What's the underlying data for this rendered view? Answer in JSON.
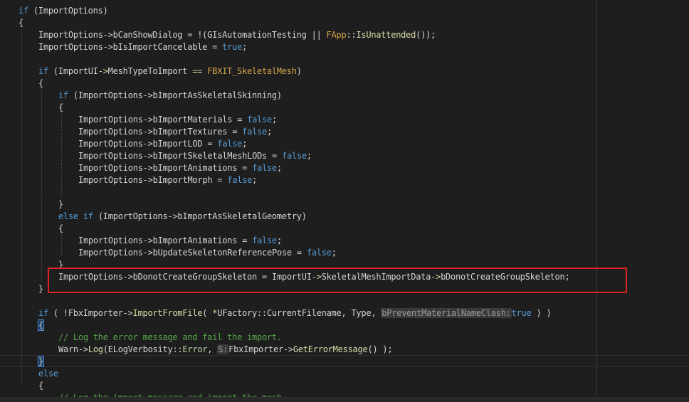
{
  "colors": {
    "keyword": "#569cd6",
    "identifier": "#d4d4d4",
    "member": "#d4d4d4",
    "function": "#dcdcaa",
    "enum": "#b8d7a3",
    "macro": "#d4a44a",
    "static": "#c8c8c8",
    "comment": "#57a64a",
    "operator_overload": "#dcdcaa",
    "warning_hl": "#d8a0df"
  },
  "code_lines": [
    {
      "indent": 0,
      "tokens": [
        [
          "if",
          "keyword"
        ],
        [
          " (ImportOptions)",
          "plain"
        ]
      ]
    },
    {
      "indent": 0,
      "tokens": [
        [
          "{",
          "plain"
        ]
      ]
    },
    {
      "indent": 1,
      "tokens": [
        [
          "ImportOptions->bCanShowDialog = !(",
          "plain"
        ],
        [
          "GIsAutomationTesting",
          "plain"
        ],
        [
          " || ",
          "plain"
        ],
        [
          "FApp",
          "macro"
        ],
        [
          "::",
          "plain"
        ],
        [
          "IsUnattended",
          "function"
        ],
        [
          "());",
          "plain"
        ]
      ]
    },
    {
      "indent": 1,
      "tokens": [
        [
          "ImportOptions->bIsImportCancelable = ",
          "plain"
        ],
        [
          "true",
          "keyword"
        ],
        [
          ";",
          "plain"
        ]
      ]
    },
    {
      "indent": 1,
      "tokens": []
    },
    {
      "indent": 1,
      "tokens": [
        [
          "if",
          "keyword"
        ],
        [
          " (ImportUI",
          "plain"
        ],
        [
          "->",
          "function"
        ],
        [
          "MeshTypeToImport",
          "plain"
        ],
        [
          " == ",
          "function"
        ],
        [
          "FBXIT_SkeletalMesh",
          "macro"
        ],
        [
          ")",
          "plain"
        ]
      ]
    },
    {
      "indent": 1,
      "tokens": [
        [
          "{",
          "plain"
        ]
      ]
    },
    {
      "indent": 2,
      "tokens": [
        [
          "if",
          "keyword"
        ],
        [
          " (ImportOptions->bImportAsSkeletalSkinning)",
          "plain"
        ]
      ]
    },
    {
      "indent": 2,
      "tokens": [
        [
          "{",
          "plain"
        ]
      ]
    },
    {
      "indent": 3,
      "tokens": [
        [
          "ImportOptions->bImportMaterials = ",
          "plain"
        ],
        [
          "false",
          "keyword"
        ],
        [
          ";",
          "plain"
        ]
      ]
    },
    {
      "indent": 3,
      "tokens": [
        [
          "ImportOptions->bImportTextures = ",
          "plain"
        ],
        [
          "false",
          "keyword"
        ],
        [
          ";",
          "plain"
        ]
      ]
    },
    {
      "indent": 3,
      "tokens": [
        [
          "ImportOptions->bImportLOD = ",
          "plain"
        ],
        [
          "false",
          "keyword"
        ],
        [
          ";",
          "plain"
        ]
      ]
    },
    {
      "indent": 3,
      "tokens": [
        [
          "ImportOptions->bImportSkeletalMeshLODs = ",
          "plain"
        ],
        [
          "false",
          "keyword"
        ],
        [
          ";",
          "plain"
        ]
      ]
    },
    {
      "indent": 3,
      "tokens": [
        [
          "ImportOptions->bImportAnimations = ",
          "plain"
        ],
        [
          "false",
          "keyword"
        ],
        [
          ";",
          "plain"
        ]
      ]
    },
    {
      "indent": 3,
      "tokens": [
        [
          "ImportOptions->bImportMorph = ",
          "plain"
        ],
        [
          "false",
          "keyword"
        ],
        [
          ";",
          "plain"
        ]
      ]
    },
    {
      "indent": 3,
      "tokens": []
    },
    {
      "indent": 2,
      "tokens": [
        [
          "}",
          "plain"
        ]
      ]
    },
    {
      "indent": 2,
      "tokens": [
        [
          "else",
          "keyword"
        ],
        [
          " ",
          "plain"
        ],
        [
          "if",
          "keyword"
        ],
        [
          " (ImportOptions->bImportAsSkeletalGeometry)",
          "plain"
        ]
      ]
    },
    {
      "indent": 2,
      "tokens": [
        [
          "{",
          "plain"
        ]
      ]
    },
    {
      "indent": 3,
      "tokens": [
        [
          "ImportOptions->bImportAnimations = ",
          "plain"
        ],
        [
          "false",
          "keyword"
        ],
        [
          ";",
          "plain"
        ]
      ]
    },
    {
      "indent": 3,
      "tokens": [
        [
          "ImportOptions->bUpdateSkeletonReferencePose = ",
          "plain"
        ],
        [
          "false",
          "keyword"
        ],
        [
          ";",
          "plain"
        ]
      ]
    },
    {
      "indent": 2,
      "tokens": [
        [
          "}",
          "plain"
        ]
      ]
    },
    {
      "indent": 2,
      "tokens": [
        [
          "ImportOptions->bDonotCreateGroupSkeleton = ImportUI",
          "plain"
        ],
        [
          "->",
          "function"
        ],
        [
          "SkeletalMeshImportData",
          "plain"
        ],
        [
          "->",
          "function"
        ],
        [
          "bDonotCreateGroupSkeleton;",
          "plain"
        ]
      ]
    },
    {
      "indent": 1,
      "tokens": [
        [
          "}",
          "plain"
        ]
      ]
    },
    {
      "indent": 1,
      "tokens": []
    },
    {
      "indent": 1,
      "tokens": [
        [
          "if",
          "keyword"
        ],
        [
          " ( !FbxImporter->",
          "plain"
        ],
        [
          "ImportFromFile",
          "function"
        ],
        [
          "( ",
          "plain"
        ],
        [
          "*",
          "function"
        ],
        [
          "UFactory",
          "plain"
        ],
        [
          "::",
          "plain"
        ],
        [
          "CurrentFilename",
          "plain"
        ],
        [
          ", Type, ",
          "plain"
        ],
        [
          "bPreventMaterialNameClash:",
          "hint"
        ],
        [
          "true",
          "keyword"
        ],
        [
          " ) )",
          "plain"
        ]
      ]
    },
    {
      "indent": 1,
      "tokens": [
        [
          "{",
          "brace"
        ]
      ]
    },
    {
      "indent": 2,
      "tokens": [
        [
          "// Log the error message and fail the import.",
          "comment"
        ]
      ]
    },
    {
      "indent": 2,
      "tokens": [
        [
          "Warn->",
          "plain"
        ],
        [
          "Log",
          "function"
        ],
        [
          "(ELogVerbosity::",
          "plain"
        ],
        [
          "Error",
          "enum"
        ],
        [
          ", ",
          "plain"
        ],
        [
          "S:",
          "hint"
        ],
        [
          "FbxImporter->",
          "plain"
        ],
        [
          "GetErrorMessage",
          "function"
        ],
        [
          "() );",
          "plain"
        ]
      ]
    },
    {
      "indent": 1,
      "tokens": [
        [
          "}",
          "brace"
        ]
      ]
    },
    {
      "indent": 1,
      "tokens": [
        [
          "else",
          "keyword"
        ]
      ]
    },
    {
      "indent": 1,
      "tokens": [
        [
          "{",
          "plain"
        ]
      ]
    },
    {
      "indent": 2,
      "tokens": [
        [
          "// Log the import message and import the mesh.",
          "comment"
        ]
      ]
    }
  ]
}
